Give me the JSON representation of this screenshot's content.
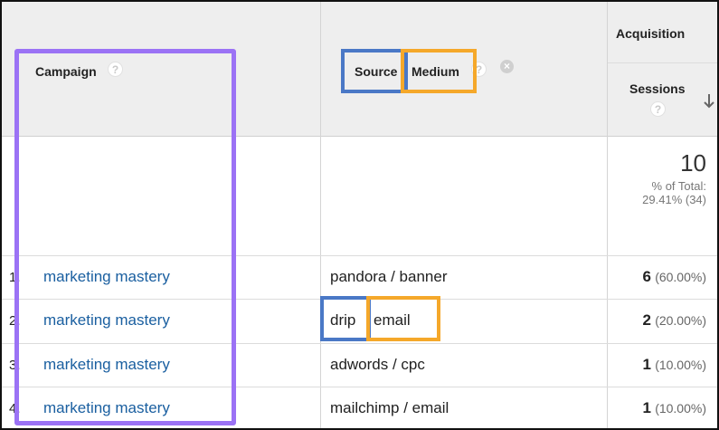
{
  "header": {
    "campaign_label": "Campaign",
    "source_label": "Source",
    "medium_label": "Medium",
    "group_label": "Acquisition",
    "sessions_label": "Sessions",
    "help_glyph": "?",
    "remove_glyph": "×"
  },
  "totals": {
    "sessions": "10",
    "pct_line1": "% of Total:",
    "pct_line2": "29.41% (34)"
  },
  "rows": [
    {
      "index": "1.",
      "campaign": "marketing mastery",
      "source_medium": "pandora / banner",
      "sessions": "6",
      "pct": "(60.00%)"
    },
    {
      "index": "2.",
      "campaign": "marketing mastery",
      "source": "drip",
      "medium": "email",
      "sessions": "2",
      "pct": "(20.00%)"
    },
    {
      "index": "3.",
      "campaign": "marketing mastery",
      "source_medium": "adwords / cpc",
      "sessions": "1",
      "pct": "(10.00%)"
    },
    {
      "index": "4.",
      "campaign": "marketing mastery",
      "source_medium": "mailchimp / email",
      "sessions": "1",
      "pct": "(10.00%)"
    }
  ],
  "colors": {
    "campaign_highlight": "#9b72f5",
    "source_highlight": "#4a78c6",
    "medium_highlight": "#f5a82a",
    "link": "#1a5fa0"
  },
  "icons": [
    "help-icon",
    "remove-dimension-icon",
    "sort-descending-arrow-icon"
  ]
}
